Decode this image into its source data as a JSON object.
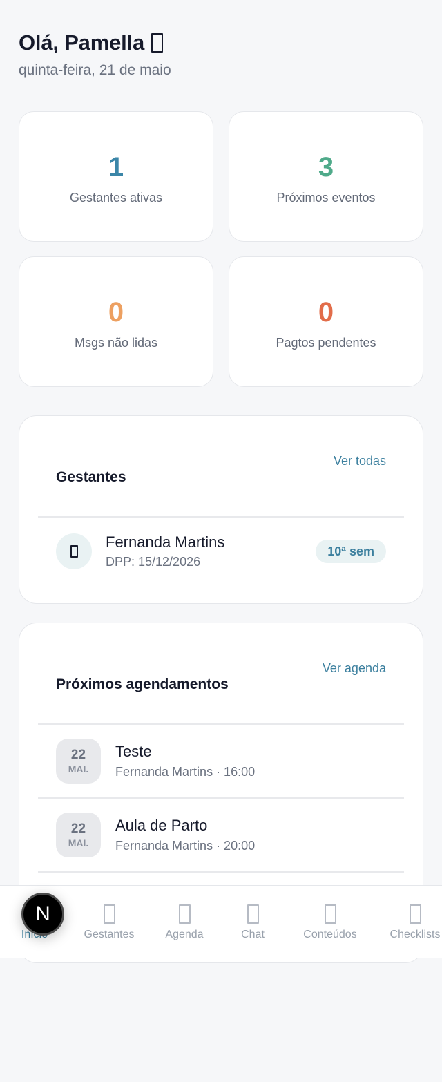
{
  "header": {
    "greeting": "Olá, Pamella",
    "date": "quinta-feira, 21 de maio"
  },
  "stats": [
    {
      "value": "1",
      "label": "Gestantes ativas",
      "color": "#3b86a8"
    },
    {
      "value": "3",
      "label": "Próximos eventos",
      "color": "#4faa8a"
    },
    {
      "value": "0",
      "label": "Msgs não lidas",
      "color": "#eda061"
    },
    {
      "value": "0",
      "label": "Pagtos pendentes",
      "color": "#e26d4a"
    }
  ],
  "gestantes": {
    "title": "Gestantes",
    "link": "Ver todas",
    "items": [
      {
        "name": "Fernanda Martins",
        "dpp": "DPP: 15/12/2026",
        "badge": "10ª sem",
        "icon": "person-icon"
      }
    ]
  },
  "agenda": {
    "title": "Próximos agendamentos",
    "link": "Ver agenda",
    "items": [
      {
        "day": "22",
        "month": "MAI.",
        "title": "Teste",
        "sub": "Fernanda Martins · 16:00"
      },
      {
        "day": "22",
        "month": "MAI.",
        "title": "Aula de Parto",
        "sub": "Fernanda Martins · 20:00"
      }
    ]
  },
  "nav": {
    "items": [
      {
        "label": "Início",
        "icon": "home-icon",
        "active": true
      },
      {
        "label": "Gestantes",
        "icon": "users-icon"
      },
      {
        "label": "Agenda",
        "icon": "calendar-icon"
      },
      {
        "label": "Chat",
        "icon": "chat-icon"
      },
      {
        "label": "Conteúdos",
        "icon": "book-icon"
      },
      {
        "label": "Checklists",
        "icon": "checklist-icon"
      }
    ]
  },
  "overlay_badge": "N",
  "colors": {
    "accent": "#3b7f9e",
    "background": "#f6f7f9"
  }
}
